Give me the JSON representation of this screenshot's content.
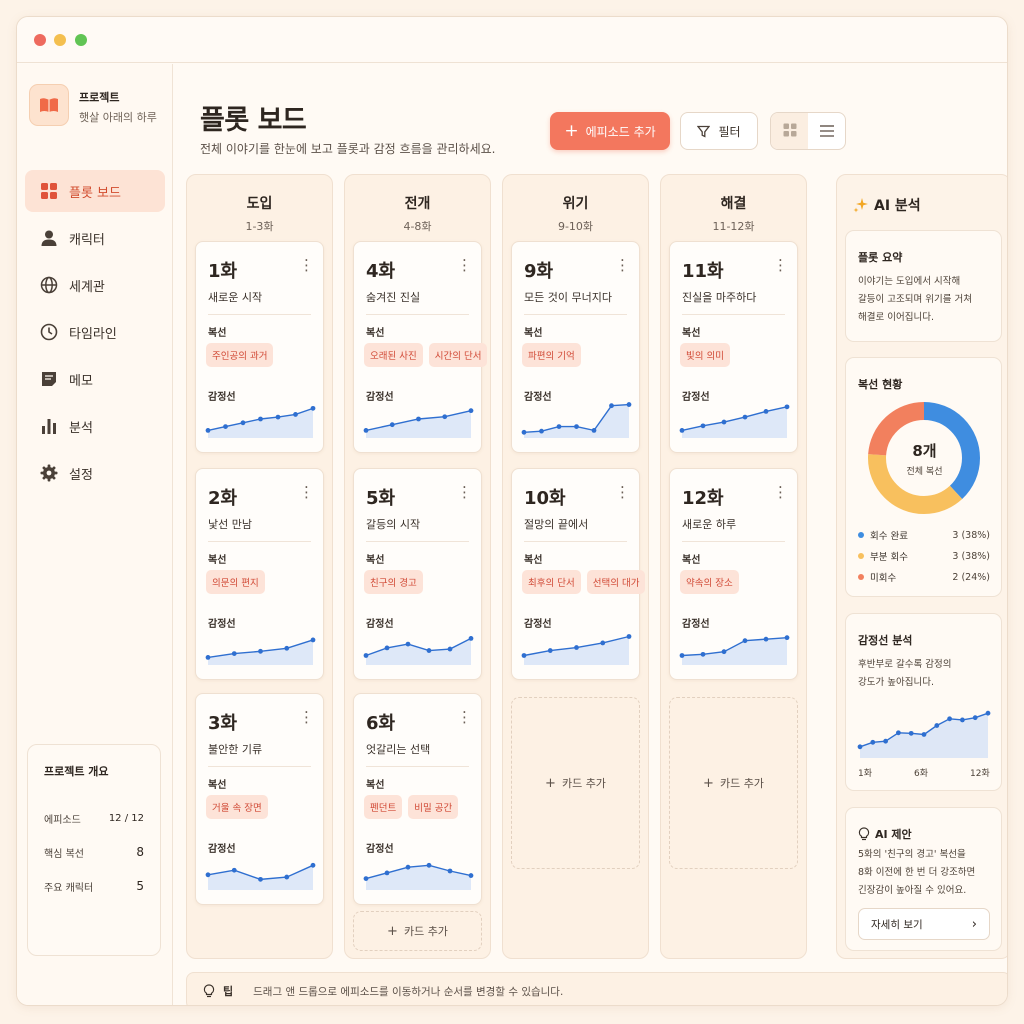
{
  "project": {
    "label": "프로젝트",
    "name": "햇살 아래의 하루"
  },
  "nav": [
    {
      "label": "플롯 보드",
      "icon": "grid-icon",
      "active": true
    },
    {
      "label": "캐릭터",
      "icon": "person-icon"
    },
    {
      "label": "세계관",
      "icon": "globe-icon"
    },
    {
      "label": "타임라인",
      "icon": "clock-icon"
    },
    {
      "label": "메모",
      "icon": "note-icon"
    },
    {
      "label": "분석",
      "icon": "bar-chart-icon"
    },
    {
      "label": "설정",
      "icon": "gear-icon"
    }
  ],
  "overview": {
    "title": "프로젝트 개요",
    "rows": [
      {
        "label": "에피소드",
        "value": "12 / 12"
      },
      {
        "label": "핵심 복선",
        "value": "8"
      },
      {
        "label": "주요 캐릭터",
        "value": "5"
      }
    ]
  },
  "header": {
    "title": "플롯 보드",
    "subtitle": "전체 이야기를 한눈에 보고 플롯과 감정 흐름을 관리하세요.",
    "add_episode": "에피소드 추가",
    "filter": "필터"
  },
  "labels": {
    "foreshadow": "복선",
    "emotion": "감정선",
    "add_card": "카드 추가"
  },
  "columns": [
    {
      "title": "도입",
      "range": "1-3화",
      "cards": [
        {
          "ep": "1화",
          "name": "새로운 시작",
          "tags": [
            "주인공의 과거"
          ],
          "emotion": [
            20,
            30,
            40,
            50,
            55,
            62,
            78
          ]
        },
        {
          "ep": "2화",
          "name": "낯선 만남",
          "tags": [
            "의문의 편지"
          ],
          "emotion": [
            20,
            30,
            36,
            44,
            66
          ]
        },
        {
          "ep": "3화",
          "name": "불안한 기류",
          "tags": [
            "거울 속 장면"
          ],
          "emotion": [
            40,
            52,
            28,
            34,
            65
          ]
        }
      ]
    },
    {
      "title": "전개",
      "range": "4-8화",
      "cards": [
        {
          "ep": "4화",
          "name": "숨겨진 진실",
          "tags": [
            "오래된 사진",
            "시간의 단서"
          ],
          "emotion": [
            20,
            35,
            50,
            56,
            72
          ]
        },
        {
          "ep": "5화",
          "name": "갈등의 시작",
          "tags": [
            "친구의 경고"
          ],
          "emotion": [
            25,
            45,
            55,
            38,
            42,
            70
          ]
        },
        {
          "ep": "6화",
          "name": "엇갈리는 선택",
          "tags": [
            "펜던트",
            "비밀 공간"
          ],
          "emotion": [
            30,
            45,
            60,
            65,
            50,
            38
          ]
        }
      ]
    },
    {
      "title": "위기",
      "range": "9-10화",
      "cards": [
        {
          "ep": "9화",
          "name": "모든 것이 무너지다",
          "tags": [
            "파편의 기억"
          ],
          "emotion": [
            15,
            18,
            30,
            30,
            20,
            85,
            88
          ]
        },
        {
          "ep": "10화",
          "name": "절망의 끝에서",
          "tags": [
            "최후의 단서",
            "선택의 대가"
          ],
          "emotion": [
            25,
            38,
            46,
            58,
            75
          ]
        }
      ]
    },
    {
      "title": "해결",
      "range": "11-12화",
      "cards": [
        {
          "ep": "11화",
          "name": "진실을 마주하다",
          "tags": [
            "빛의 의미"
          ],
          "emotion": [
            20,
            32,
            42,
            55,
            70,
            82
          ]
        },
        {
          "ep": "12화",
          "name": "새로운 하루",
          "tags": [
            "약속의 장소"
          ],
          "emotion": [
            25,
            28,
            35,
            64,
            68,
            72
          ]
        }
      ]
    }
  ],
  "ai": {
    "title": "AI 분석",
    "summary": {
      "title": "플롯 요약",
      "text": "이야기는 도입에서 시작해\n갈등이 고조되며 위기를 거쳐\n해결로 이어집니다."
    },
    "foreshadow": {
      "title": "복선 현황",
      "center_value": "8개",
      "center_label": "전체 복선",
      "items": [
        {
          "label": "회수 완료",
          "value": "3 (38%)",
          "color": "#3f8de0",
          "share": 38
        },
        {
          "label": "부분 회수",
          "value": "3 (38%)",
          "color": "#f8c05e",
          "share": 38
        },
        {
          "label": "미회수",
          "value": "2 (24%)",
          "color": "#f2805e",
          "share": 24
        }
      ]
    },
    "emotion": {
      "title": "감정선 분석",
      "text": "후반부로 갈수록 감정의\n강도가 높아집니다.",
      "ticks": [
        "1화",
        "6화",
        "12화"
      ],
      "values": [
        20,
        28,
        30,
        45,
        44,
        42,
        58,
        70,
        68,
        72,
        80
      ]
    },
    "suggestion": {
      "title": "AI 제안",
      "text": "5화의 '친구의 경고' 복선을\n8화 이전에 한 번 더 강조하면\n긴장감이 높아질 수 있어요.",
      "button": "자세히 보기"
    }
  },
  "tip": {
    "label": "팁",
    "text": "드래그 앤 드롭으로 에피소드를 이동하거나 순서를 변경할 수 있습니다."
  },
  "colors": {
    "accent": "#f3775e",
    "chart_line": "#2f6fd0",
    "chart_fill": "#d3e0f7"
  }
}
